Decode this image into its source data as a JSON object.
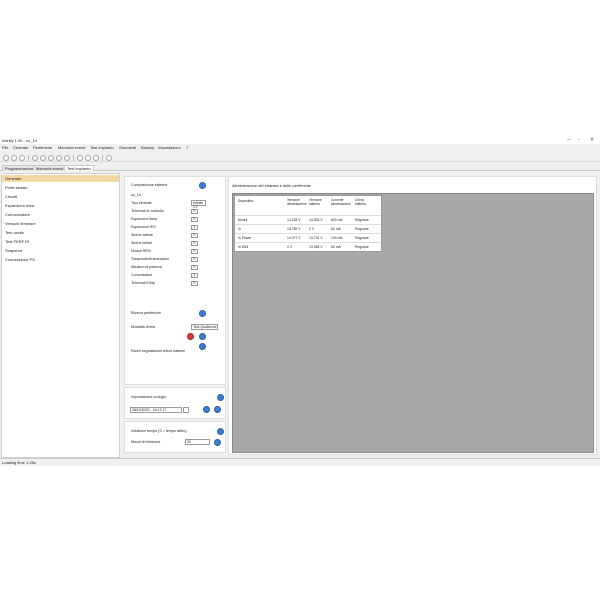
{
  "window": {
    "title": "Infinity 1.00 - co_1h",
    "controls": [
      "–",
      "▫",
      "✕"
    ]
  },
  "menu": [
    "File",
    "Centrale",
    "Periferiche",
    "Memoria eventi",
    "Test impianto",
    "Strumenti",
    "Backup",
    "Impostazioni",
    "?"
  ],
  "tabs": [
    {
      "label": "Programmazione"
    },
    {
      "label": "Memoria eventi"
    },
    {
      "label": "Test impianto"
    }
  ],
  "sidebar": {
    "items": [
      {
        "label": "Generale"
      },
      {
        "label": "Porte seriale"
      },
      {
        "label": "Circuiti"
      },
      {
        "label": "Espansioni linea"
      },
      {
        "label": "Comunicatore"
      },
      {
        "label": "Versioni firmware"
      },
      {
        "label": "Test uscite"
      },
      {
        "label": "Test PERF IR"
      },
      {
        "label": "Snapshot"
      },
      {
        "label": "Connessione PS"
      }
    ]
  },
  "system": {
    "title": "Composizione sistema",
    "name": "co_1h",
    "rows": [
      {
        "label": "Tipo centrale",
        "value": "Infinite CY"
      },
      {
        "label": "Terminali di controllo",
        "value": "0"
      },
      {
        "label": "Espansioni linea",
        "value": "0"
      },
      {
        "label": "Espansioni IPG",
        "value": "1"
      },
      {
        "label": "Sirene cablati",
        "value": "0"
      },
      {
        "label": "Sirene infilati",
        "value": "0"
      },
      {
        "label": "Moduli REM",
        "value": "0"
      },
      {
        "label": "Trasponder/transceptori",
        "value": "0"
      },
      {
        "label": "Attuatori di potenza",
        "value": "0"
      },
      {
        "label": "Comunicatori",
        "value": "1"
      },
      {
        "label": "Terminali Ethtp",
        "value": "0"
      }
    ],
    "peripheral_search": "Ricerca periferiche",
    "tester_model_label": "Modalità di test",
    "tester_model_value": "Test Quattrovie",
    "diag_label": "Ricevi segnalazioni check batterie"
  },
  "clock": {
    "title": "Impostazione orologio",
    "datetime": "28/10/2020 · 16:12:17"
  },
  "sleep": {
    "title": "Inibizione tempo (S = tempo attivo)",
    "minutes_label": "Minuti di inibizione",
    "minutes_value": "30"
  },
  "power": {
    "title": "Alimentazione del sistema e delle periferiche",
    "columns": [
      "Dispositivo",
      "Tensione alimentazione",
      "Tensione batteria",
      "Corrente alimentazione",
      "Check batteria"
    ],
    "rows": [
      [
        "Modul",
        "14,228 V",
        "14,063 V",
        "603 mA",
        "Regolare"
      ],
      [
        "In",
        "13,789 V",
        "0 V",
        "60 mA",
        "Regolare"
      ],
      [
        "In Power",
        "14,077 V",
        "13,732 V",
        "100 mA",
        "Regolare"
      ],
      [
        "In WDI",
        "0 V",
        "13,286 V",
        "60 mA",
        "Regolare"
      ]
    ]
  },
  "status": "Loading time 1,25s"
}
